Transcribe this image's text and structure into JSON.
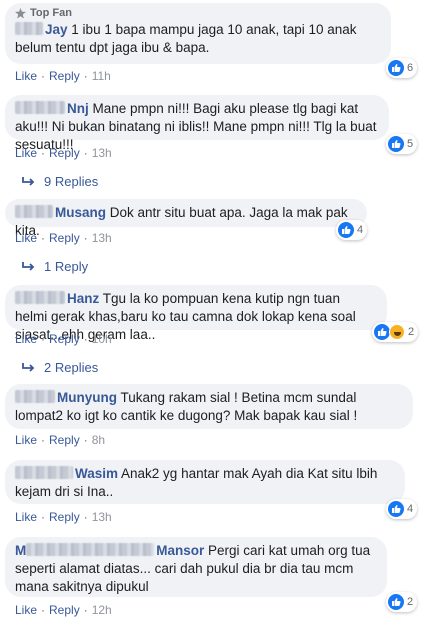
{
  "comments": [
    {
      "badge": "Top Fan",
      "name": "Jay",
      "text": "1 ibu 1 bapa mampu jaga 10 anak, tapi 10 anak belum tentu dpt jaga ibu & bapa.",
      "like": "Like",
      "reply": "Reply",
      "time": "11h",
      "reaction_count": "6"
    },
    {
      "name": "Nnj",
      "text": "Mane pmpn ni!!! Bagi aku please tlg bagi kat aku!!! Ni bukan binatang ni iblis!! Mane pmpn ni!!! Tlg la buat sesuatu!!!",
      "like": "Like",
      "reply": "Reply",
      "time": "13h",
      "reaction_count": "5",
      "replies": "9 Replies"
    },
    {
      "name": "Musang",
      "text": "Dok antr situ buat apa. Jaga la mak pak kita.",
      "like": "Like",
      "reply": "Reply",
      "time": "13h",
      "reaction_count": "4",
      "replies": "1 Reply"
    },
    {
      "name": "Hanz",
      "text": "Tgu la ko pompuan kena kutip ngn tuan helmi gerak khas,baru ko tau camna dok lokap kena soal siasat...ehh geram laa..",
      "like": "Like",
      "reply": "Reply",
      "time": "10h",
      "reaction_count": "2",
      "replies": "2 Replies"
    },
    {
      "name": "Munyung",
      "text": "Tukang rakam sial ! Betina mcm sundal lompat2 ko igt ko cantik ke dugong? Mak bapak kau sial !",
      "like": "Like",
      "reply": "Reply",
      "time": "8h"
    },
    {
      "name": "Wasim",
      "text": "Anak2 yg hantar mak Ayah dia Kat situ lbih kejam dri si Ina..",
      "like": "Like",
      "reply": "Reply",
      "time": "13h",
      "reaction_count": "4"
    },
    {
      "name_prefix": "M",
      "name": "Mansor",
      "text": "Pergi cari kat umah org tua seperti alamat diatas... cari dah pukul dia br dia tau mcm mana sakitnya dipukul",
      "like": "Like",
      "reply": "Reply",
      "time": "12h",
      "reaction_count": "2"
    }
  ],
  "colors": {
    "link": "#385898",
    "bubble": "#f0f2f5",
    "like_blue": "#1877f2"
  }
}
